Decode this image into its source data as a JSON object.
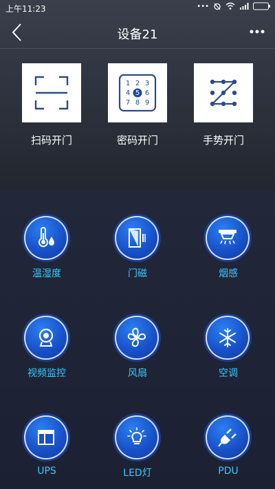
{
  "status_bar": {
    "time": "上午11:23"
  },
  "header": {
    "title": "设备21"
  },
  "open_methods": [
    {
      "label": "扫码开门",
      "icon": "scan-icon"
    },
    {
      "label": "密码开门",
      "icon": "keypad-icon",
      "keys": [
        "1",
        "2",
        "3",
        "4",
        "5",
        "6",
        "7",
        "8",
        "9"
      ],
      "highlighted_key": "5"
    },
    {
      "label": "手势开门",
      "icon": "pattern-icon"
    }
  ],
  "devices": [
    {
      "label": "温湿度",
      "icon": "thermometer-icon"
    },
    {
      "label": "门磁",
      "icon": "door-icon"
    },
    {
      "label": "烟感",
      "icon": "smoke-detector-icon"
    },
    {
      "label": "视频监控",
      "icon": "camera-icon"
    },
    {
      "label": "风扇",
      "icon": "fan-icon"
    },
    {
      "label": "空调",
      "icon": "snowflake-icon"
    },
    {
      "label": "UPS",
      "icon": "ups-icon"
    },
    {
      "label": "LED灯",
      "icon": "bulb-icon"
    },
    {
      "label": "PDU",
      "icon": "plug-icon"
    }
  ],
  "colors": {
    "accent": "#3bc9ff",
    "icon_blue": "#1850c8"
  }
}
